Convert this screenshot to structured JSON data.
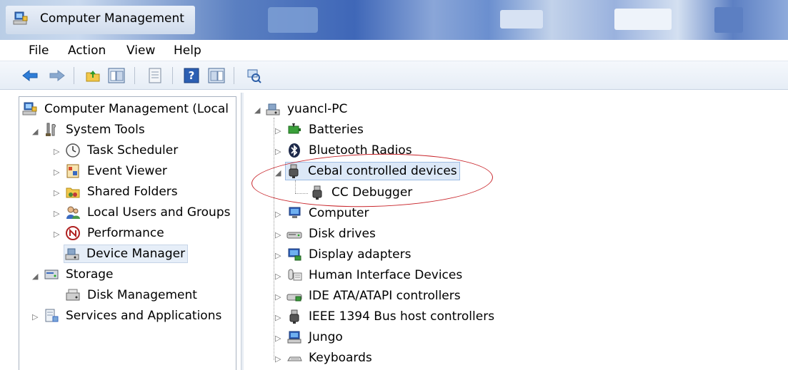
{
  "window": {
    "title": "Computer Management"
  },
  "menu": [
    "File",
    "Action",
    "View",
    "Help"
  ],
  "toolbar": {
    "buttons": [
      "back-icon",
      "forward-icon",
      "up-folder-icon",
      "show-hide-console-tree-icon",
      "properties-icon",
      "help-icon",
      "show-hide-action-pane-icon",
      "scan-hardware-icon"
    ]
  },
  "left_tree": {
    "root": "Computer Management (Local",
    "system_tools": "System Tools",
    "task_scheduler": "Task Scheduler",
    "event_viewer": "Event Viewer",
    "shared_folders": "Shared Folders",
    "local_users": "Local Users and Groups",
    "performance": "Performance",
    "device_manager": "Device Manager",
    "storage": "Storage",
    "disk_management": "Disk Management",
    "services": "Services and Applications"
  },
  "device_tree": {
    "root": "yuancl-PC",
    "batteries": "Batteries",
    "bluetooth": "Bluetooth Radios",
    "cebal": "Cebal controlled devices",
    "cc_debugger": "CC Debugger",
    "computer": "Computer",
    "disk_drives": "Disk drives",
    "display": "Display adapters",
    "hid": "Human Interface Devices",
    "ide": "IDE ATA/ATAPI controllers",
    "ieee": "IEEE 1394 Bus host controllers",
    "jungo": "Jungo",
    "keyboards": "Keyboards"
  },
  "colors": {
    "annotation": "#c8242a",
    "selection": "#dce8f7"
  }
}
